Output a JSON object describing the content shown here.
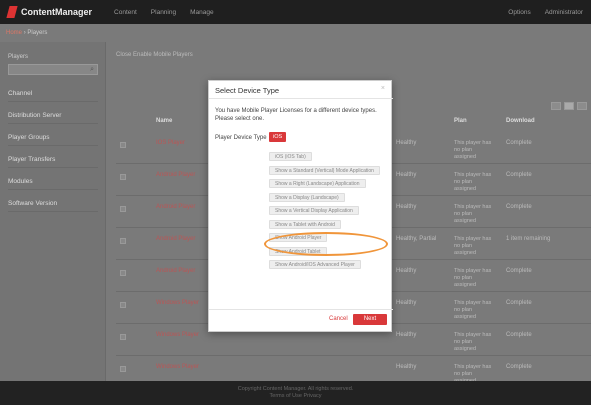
{
  "app": {
    "brand": "ContentManager",
    "nav": [
      "Content",
      "Planning",
      "Manage"
    ],
    "top_right": [
      "Options",
      "Administrator"
    ]
  },
  "breadcrumb": {
    "home": "Home",
    "current": "Players"
  },
  "sidebar": {
    "label": "Players",
    "search_placeholder": "Search",
    "items": [
      {
        "label": "Channel"
      },
      {
        "label": "Distribution Server"
      },
      {
        "label": "Player Groups"
      },
      {
        "label": "Player Transfers"
      },
      {
        "label": "Modules"
      },
      {
        "label": "Software Version"
      }
    ]
  },
  "main": {
    "toolbar": "Close   Enable Mobile Players",
    "table": {
      "headers": [
        "Name",
        "",
        "Plan",
        "Download"
      ],
      "rows": [
        {
          "name": "IOS Player",
          "mid": "Healthy",
          "plan": "This player has no plan assigned",
          "download": "Complete"
        },
        {
          "name": "Android Player",
          "mid": "Healthy",
          "plan": "This player has no plan assigned",
          "download": "Complete"
        },
        {
          "name": "Android Player",
          "mid": "Healthy",
          "plan": "This player has no plan assigned",
          "download": "Complete"
        },
        {
          "name": "Android Player",
          "mid": "Healthy, Partial",
          "plan": "This player has no plan assigned",
          "download": "1 item remaining"
        },
        {
          "name": "Android Player",
          "mid": "Healthy",
          "plan": "This player has no plan assigned",
          "download": "Complete"
        },
        {
          "name": "Windows Player",
          "mid": "Healthy",
          "plan": "This player has no plan assigned",
          "download": "Complete"
        },
        {
          "name": "Windows Player",
          "mid": "Healthy",
          "plan": "This player has no plan assigned",
          "download": "Complete"
        },
        {
          "name": "Windows Player",
          "mid": "Healthy",
          "plan": "This player has no plan assigned",
          "download": "Complete"
        }
      ]
    }
  },
  "modal": {
    "title": "Select Device Type",
    "close": "×",
    "message": "You have Mobile Player Licenses for a different device types. Please select one.",
    "device_type_label": "Player Device Type",
    "selected_value": "iOS",
    "options": [
      "iOS (iOS Tab)",
      "Show a Standard (Vertical) Mode Application",
      "Show a Right (Landscape) Application",
      "Show a Display (Landscape)",
      "Show a Vertical Display Application",
      "Show a Tablet with Android",
      "Show Android Player",
      "Show Android Tablet",
      "Show Android/IOS Advanced Player"
    ],
    "cancel": "Cancel",
    "next": "Next"
  },
  "footer": {
    "line1": "Copyright Content Manager. All rights reserved.",
    "line2": "Terms of Use   Privacy"
  },
  "colors": {
    "accent": "#d9383a",
    "highlight": "#f0953a"
  }
}
